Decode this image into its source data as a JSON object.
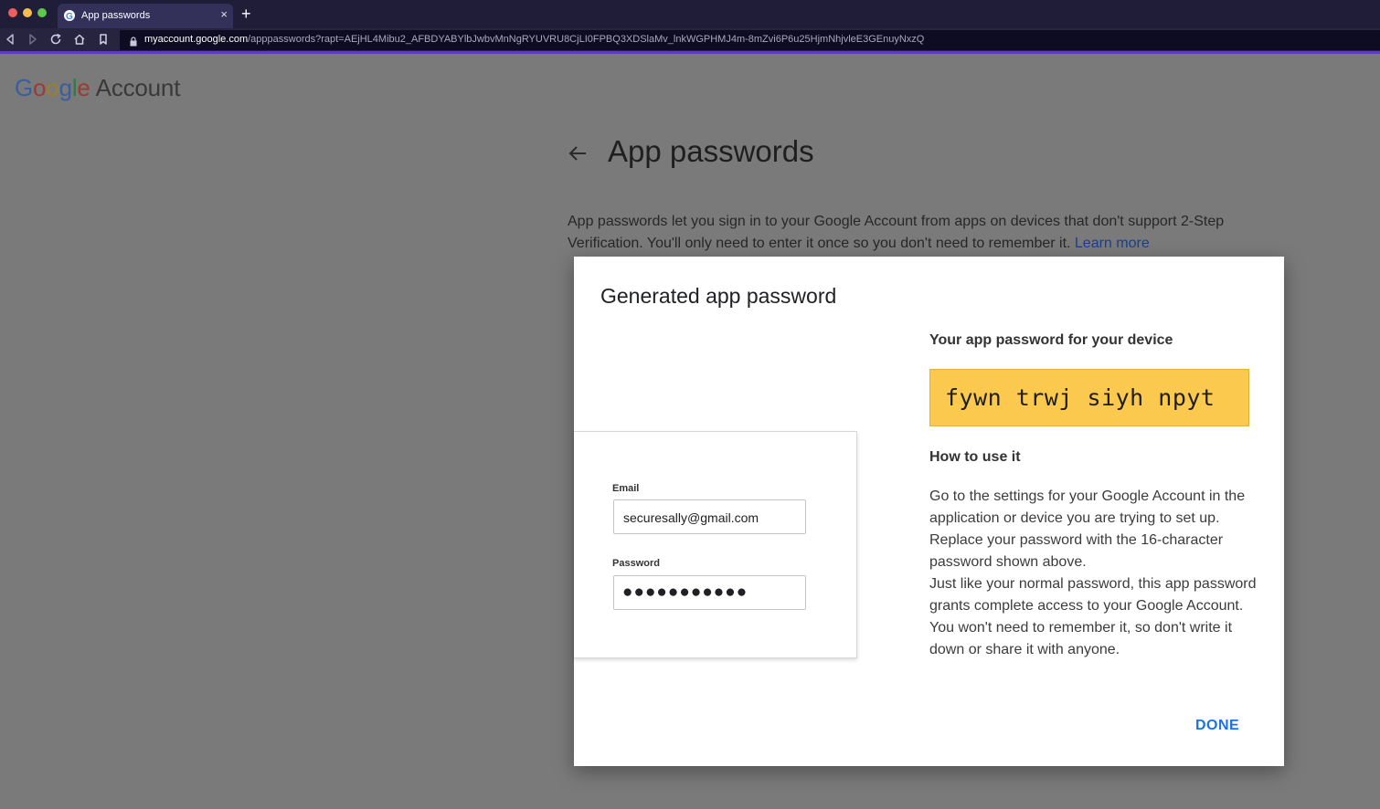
{
  "browser": {
    "tab_title": "App passwords",
    "tab_close": "×",
    "new_tab": "+",
    "url_host": "myaccount.google.com",
    "url_path": "/apppasswords?rapt=AEjHL4Mibu2_AFBDYABYlbJwbvMnNgRYUVRU8CjLI0FPBQ3XDSlaMv_lnkWGPHMJ4m-8mZvi6P6u25HjmNhjvleE3GEnuyNxzQ",
    "icons": [
      "back-icon",
      "forward-icon",
      "reload-icon",
      "home-icon",
      "bookmark-icon",
      "lock-icon"
    ]
  },
  "header": {
    "logo_letters": [
      "G",
      "o",
      "o",
      "g",
      "l",
      "e"
    ],
    "logo_suffix": "Account"
  },
  "page": {
    "title": "App passwords",
    "intro": "App passwords let you sign in to your Google Account from apps on devices that don't support 2-Step Verification. You'll only need to enter it once so you don't need to remember it.",
    "learn_more": "Learn more"
  },
  "dialog": {
    "title": "Generated app password",
    "illustration": {
      "email_label": "Email",
      "email_value": "securesally@gmail.com",
      "password_label": "Password",
      "password_value": "●●●●●●●●●●●"
    },
    "your_password_label": "Your app password for your device",
    "app_password": "fywn trwj siyh npyt",
    "how_title": "How to use it",
    "how_p1": "Go to the settings for your Google Account in the application or device you are trying to set up. Replace your password with the 16-character password shown above.",
    "how_p2": "Just like your normal password, this app password grants complete access to your Google Account. You won't need to remember it, so don't write it down or share it with anyone.",
    "done_label": "DONE"
  },
  "colors": {
    "accent": "#1a73e8",
    "password_highlight": "#fbc94e",
    "chrome_bg": "#1f1d38"
  }
}
